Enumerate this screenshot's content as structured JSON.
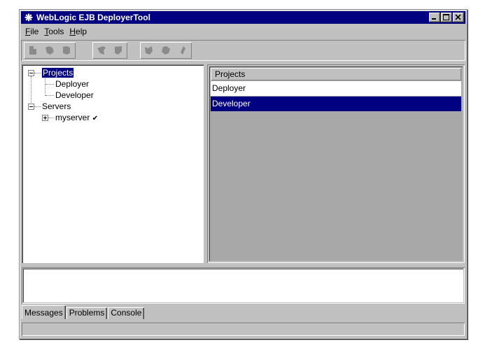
{
  "window": {
    "title": "WebLogic EJB DeployerTool"
  },
  "menu": {
    "items": [
      {
        "label": "File",
        "mnemonic": "F",
        "rest": "ile"
      },
      {
        "label": "Tools",
        "mnemonic": "T",
        "rest": "ools"
      },
      {
        "label": "Help",
        "mnemonic": "H",
        "rest": "elp"
      }
    ]
  },
  "toolbar": {
    "groups": [
      [
        "new-icon",
        "open-icon",
        "save-icon"
      ],
      [
        "deploy-icon",
        "undeploy-icon"
      ],
      [
        "build-icon",
        "validate-icon",
        "run-icon"
      ]
    ]
  },
  "tree": {
    "projects": "Projects",
    "deployer": "Deployer",
    "developer": "Developer",
    "servers": "Servers",
    "myserver": "myserver",
    "check": "✔"
  },
  "table": {
    "header": "Projects",
    "rows": [
      "Deployer",
      "Developer"
    ],
    "selected_index": 1
  },
  "tabs": {
    "messages": "Messages",
    "problems": "Problems",
    "console": "Console",
    "active": "Messages"
  },
  "colors": {
    "titlebar": "#000080",
    "selection": "#000080",
    "face": "#c0c0c0"
  }
}
